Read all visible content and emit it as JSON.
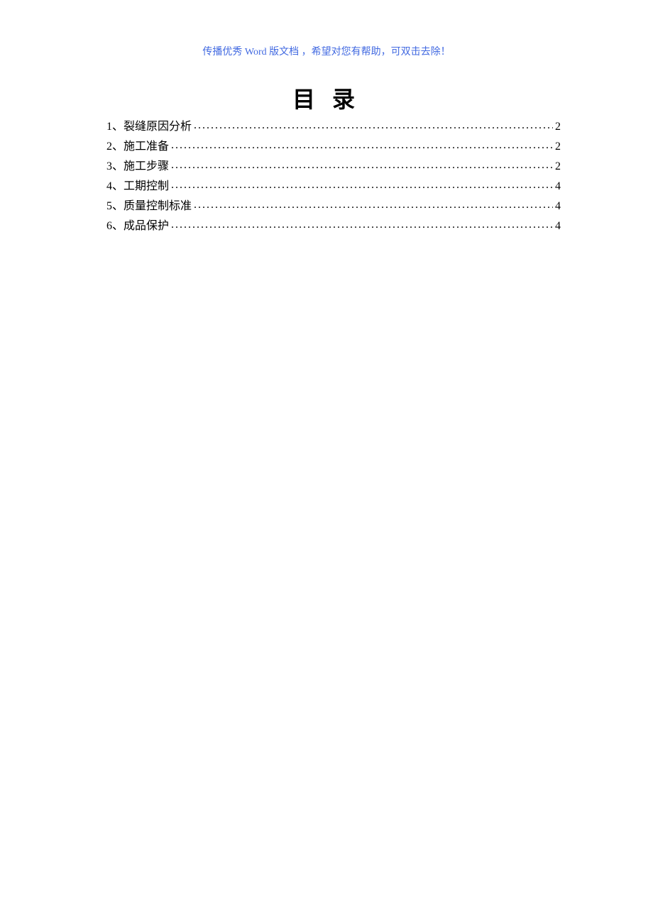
{
  "header_note": "传播优秀 Word 版文档 ，希望对您有帮助，可双击去除！",
  "title": "目 录",
  "toc": [
    {
      "label": "1、裂缝原因分析 ",
      "page": "2"
    },
    {
      "label": "2、施工准备 ",
      "page": "2"
    },
    {
      "label": "3、施工步骤 ",
      "page": "2"
    },
    {
      "label": "4、工期控制 ",
      "page": "4"
    },
    {
      "label": "5、质量控制标准 ",
      "page": "4"
    },
    {
      "label": "6、成品保护 ",
      "page": "4"
    }
  ]
}
